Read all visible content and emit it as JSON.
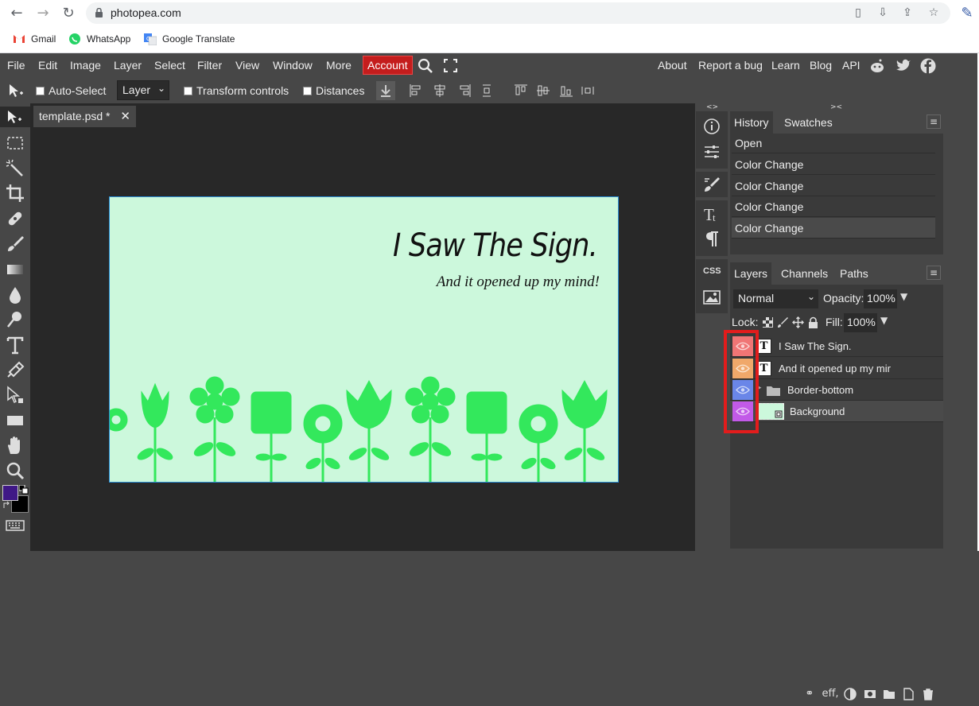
{
  "browser": {
    "url": "photopea.com",
    "bookmarks": [
      {
        "label": "Gmail",
        "icon": "gmail-icon"
      },
      {
        "label": "WhatsApp",
        "icon": "whatsapp-icon"
      },
      {
        "label": "Google Translate",
        "icon": "google-translate-icon"
      }
    ]
  },
  "menubar": {
    "items": [
      "File",
      "Edit",
      "Image",
      "Layer",
      "Select",
      "Filter",
      "View",
      "Window",
      "More"
    ],
    "account": "Account",
    "right_links": [
      "About",
      "Report a bug",
      "Learn",
      "Blog",
      "API"
    ]
  },
  "options": {
    "auto_select": "Auto-Select",
    "layer_select": "Layer",
    "transform_controls": "Transform controls",
    "distances": "Distances"
  },
  "document": {
    "tab_label": "template.psd *",
    "tab_close": "✕",
    "canvas_title": "I Saw The Sign.",
    "canvas_subtitle": "And it opened up my mind!",
    "canvas_bg": "#ccf8dc",
    "flower_color": "#33e85c"
  },
  "icon_panel": {
    "css_label": "CSS"
  },
  "history": {
    "tabs": [
      "History",
      "Swatches"
    ],
    "rows": [
      "Open",
      "Color Change",
      "Color Change",
      "Color Change",
      "Color Change"
    ]
  },
  "layers": {
    "tabs": [
      "Layers",
      "Channels",
      "Paths"
    ],
    "blend_mode": "Normal",
    "opacity_label": "Opacity:",
    "opacity_value": "100%",
    "lock_label": "Lock:",
    "fill_label": "Fill:",
    "fill_value": "100%",
    "rows": [
      {
        "name": "I Saw The Sign.",
        "type": "text",
        "eye_color": "#f07575"
      },
      {
        "name": "And it opened up my mir",
        "type": "text",
        "eye_color": "#f0a86a"
      },
      {
        "name": "Border-bottom",
        "type": "folder",
        "eye_color": "#6a86e8"
      },
      {
        "name": "Background",
        "type": "image",
        "eye_color": "#c25ae8"
      }
    ],
    "footer_fx": "eff,"
  },
  "colors": {
    "foreground": "#3f1886",
    "background": "#000000",
    "highlight": "#e21c1c",
    "account_bg": "#c41d1d"
  }
}
